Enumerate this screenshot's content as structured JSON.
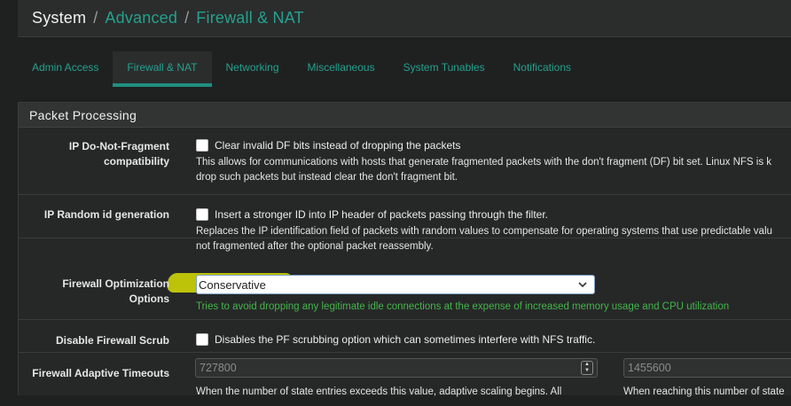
{
  "breadcrumb": {
    "root": "System",
    "level2": "Advanced",
    "level3": "Firewall & NAT"
  },
  "tabs": [
    {
      "label": "Admin Access"
    },
    {
      "label": "Firewall & NAT"
    },
    {
      "label": "Networking"
    },
    {
      "label": "Miscellaneous"
    },
    {
      "label": "System Tunables"
    },
    {
      "label": "Notifications"
    }
  ],
  "panel": {
    "title": "Packet Processing"
  },
  "dnf": {
    "label_line1": "IP Do-Not-Fragment",
    "label_line2": "compatibility",
    "checkbox_label": "Clear invalid DF bits instead of dropping the packets",
    "help_line1": "This allows for communications with hosts that generate fragmented packets with the don't fragment (DF) bit set. Linux NFS is k",
    "help_line2": "drop such packets but instead clear the don't fragment bit.",
    "checked": false
  },
  "random_id": {
    "label": "IP Random id generation",
    "checkbox_label": "Insert a stronger ID into IP header of packets passing through the filter.",
    "help_line1": "Replaces the IP identification field of packets with random values to compensate for operating systems that use predictable valu",
    "help_line2": "not fragmented after the optional packet reassembly.",
    "checked": false
  },
  "optimization": {
    "label_line1": "Firewall Optimization",
    "label_line2": "Options",
    "selected": "Conservative",
    "help": "Tries to avoid dropping any legitimate idle connections at the expense of increased memory usage and CPU utilization"
  },
  "scrub": {
    "label": "Disable Firewall Scrub",
    "checkbox_label": "Disables the PF scrubbing option which can sometimes interfere with NFS traffic.",
    "checked": false
  },
  "adaptive": {
    "label": "Firewall Adaptive Timeouts",
    "start_placeholder": "727800",
    "end_placeholder": "1455600",
    "start_help": "When the number of state entries exceeds this value, adaptive scaling begins. All",
    "end_help": "When reaching this number of state"
  },
  "colors": {
    "accent": "#25a18e",
    "help_green": "#44b54a",
    "highlight": "#e7f000"
  }
}
